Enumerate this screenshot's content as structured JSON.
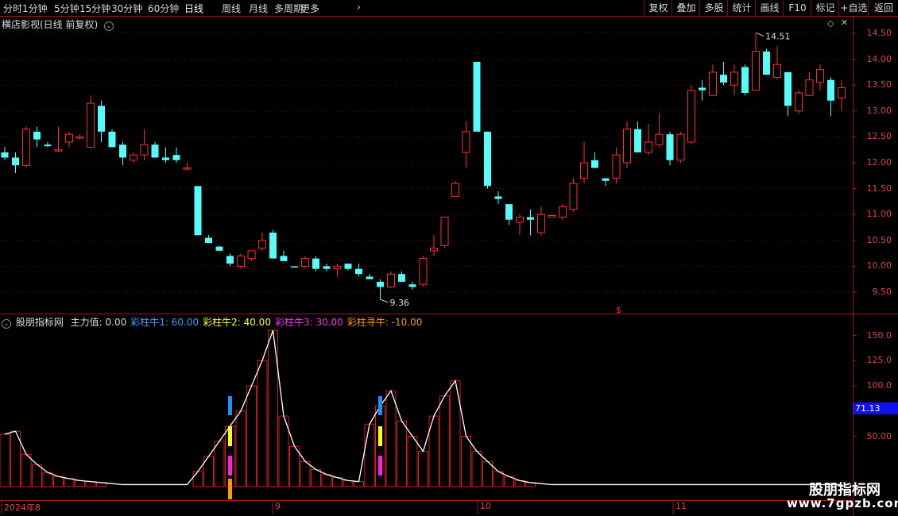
{
  "toolbar": {
    "periods": [
      "分时",
      "1分钟",
      "5分钟",
      "15分钟",
      "30分钟",
      "60分钟",
      "日线",
      "周线",
      "月线",
      "多周期",
      "更多"
    ],
    "active_period": "日线",
    "right_buttons": [
      "复权",
      "叠加",
      "多股",
      "统计",
      "画线",
      "F10",
      "标记",
      "+自选",
      "返回"
    ]
  },
  "main_chart": {
    "title": "横店影视(日线 前复权)",
    "y_ticks": [
      "14.50",
      "14.00",
      "13.50",
      "13.00",
      "12.50",
      "12.00",
      "11.50",
      "11.00",
      "10.50",
      "10.00",
      "9.50"
    ],
    "high_label": "14.51",
    "low_label": "9.36",
    "marker_label": "$"
  },
  "indicator": {
    "name": "股朋指标网",
    "legend": [
      {
        "text": "主力值: 0.00",
        "color": "#dddddd"
      },
      {
        "text": "彩柱牛1: 60.00",
        "color": "#3aa0ff"
      },
      {
        "text": "彩柱牛2: 40.00",
        "color": "#ffff00"
      },
      {
        "text": "彩柱牛3: 30.00",
        "color": "#ff30ff"
      },
      {
        "text": "彩柱寻牛: -10.00",
        "color": "#ff9900"
      }
    ],
    "y_ticks": [
      "150.0",
      "125.0",
      "100.0",
      "75.00",
      "50.00"
    ],
    "current_value": "71.13"
  },
  "x_axis": {
    "labels": [
      "2024年8",
      "9",
      "10",
      "11"
    ]
  },
  "watermark": {
    "line1": "股朋指标网",
    "line2": "www.7gpzb.com"
  },
  "chart_data": {
    "type": "candlestick",
    "ohlc": [
      [
        12.2,
        12.3,
        12.05,
        12.1
      ],
      [
        12.1,
        12.2,
        11.8,
        11.95
      ],
      [
        11.95,
        12.7,
        11.9,
        12.65
      ],
      [
        12.6,
        12.7,
        12.3,
        12.45
      ],
      [
        12.35,
        12.4,
        12.3,
        12.32
      ],
      [
        12.25,
        12.7,
        12.2,
        12.25
      ],
      [
        12.4,
        12.6,
        12.3,
        12.55
      ],
      [
        12.5,
        12.55,
        12.45,
        12.5
      ],
      [
        12.3,
        13.3,
        12.28,
        13.15
      ],
      [
        13.1,
        13.2,
        12.4,
        12.6
      ],
      [
        12.6,
        12.65,
        12.3,
        12.3
      ],
      [
        12.35,
        12.4,
        11.95,
        12.1
      ],
      [
        12.05,
        12.2,
        12.0,
        12.15
      ],
      [
        12.15,
        12.65,
        12.05,
        12.35
      ],
      [
        12.35,
        12.4,
        12.1,
        12.1
      ],
      [
        12.1,
        12.3,
        12.0,
        12.05
      ],
      [
        12.15,
        12.3,
        12.0,
        12.05
      ],
      [
        11.9,
        12.0,
        11.85,
        11.9
      ],
      [
        11.55,
        11.55,
        10.6,
        10.6
      ],
      [
        10.55,
        10.6,
        10.45,
        10.45
      ],
      [
        10.38,
        10.4,
        10.3,
        10.3
      ],
      [
        10.2,
        10.25,
        10.0,
        10.05
      ],
      [
        10.0,
        10.25,
        9.95,
        10.2
      ],
      [
        10.15,
        10.3,
        10.1,
        10.3
      ],
      [
        10.35,
        10.65,
        10.3,
        10.5
      ],
      [
        10.65,
        10.7,
        10.2,
        10.15
      ],
      [
        10.2,
        10.3,
        10.1,
        10.1
      ],
      [
        10.0,
        10.0,
        9.98,
        9.99
      ],
      [
        10.0,
        10.2,
        9.95,
        10.15
      ],
      [
        10.15,
        10.2,
        9.9,
        9.95
      ],
      [
        10.0,
        10.05,
        9.9,
        9.95
      ],
      [
        9.95,
        10.05,
        9.8,
        10.0
      ],
      [
        10.05,
        10.05,
        9.92,
        9.95
      ],
      [
        9.95,
        10.05,
        9.8,
        9.85
      ],
      [
        9.8,
        9.85,
        9.75,
        9.75
      ],
      [
        9.7,
        9.75,
        9.36,
        9.6
      ],
      [
        9.6,
        9.9,
        9.58,
        9.85
      ],
      [
        9.85,
        9.9,
        9.7,
        9.7
      ],
      [
        9.65,
        9.7,
        9.55,
        9.6
      ],
      [
        9.65,
        10.2,
        9.6,
        10.15
      ],
      [
        10.3,
        10.6,
        10.2,
        10.35
      ],
      [
        10.4,
        10.95,
        10.35,
        10.95
      ],
      [
        11.35,
        11.65,
        11.35,
        11.6
      ],
      [
        12.2,
        12.8,
        11.9,
        12.6
      ],
      [
        13.95,
        13.95,
        12.6,
        12.6
      ],
      [
        12.6,
        12.6,
        11.5,
        11.55
      ],
      [
        11.35,
        11.45,
        11.2,
        11.3
      ],
      [
        11.2,
        11.2,
        10.8,
        10.9
      ],
      [
        10.85,
        11.0,
        10.6,
        10.95
      ],
      [
        10.95,
        11.1,
        10.6,
        10.9
      ],
      [
        10.65,
        11.15,
        10.6,
        11.0
      ],
      [
        10.95,
        11.0,
        10.95,
        10.98
      ],
      [
        10.95,
        11.2,
        10.9,
        11.15
      ],
      [
        11.1,
        11.7,
        11.05,
        11.6
      ],
      [
        11.7,
        12.4,
        11.6,
        12.0
      ],
      [
        12.05,
        12.2,
        11.9,
        11.9
      ],
      [
        11.7,
        11.7,
        11.55,
        11.65
      ],
      [
        11.7,
        12.3,
        11.6,
        12.15
      ],
      [
        12.0,
        12.8,
        11.9,
        12.65
      ],
      [
        12.65,
        12.8,
        12.2,
        12.2
      ],
      [
        12.2,
        12.75,
        12.15,
        12.4
      ],
      [
        12.35,
        12.95,
        12.3,
        12.55
      ],
      [
        12.55,
        12.6,
        11.95,
        12.05
      ],
      [
        12.05,
        12.6,
        12.0,
        12.55
      ],
      [
        12.4,
        13.5,
        12.35,
        13.4
      ],
      [
        13.45,
        13.6,
        13.2,
        13.4
      ],
      [
        13.3,
        13.9,
        13.3,
        13.75
      ],
      [
        13.7,
        13.95,
        13.5,
        13.55
      ],
      [
        13.5,
        13.9,
        13.3,
        13.75
      ],
      [
        13.85,
        13.9,
        13.3,
        13.35
      ],
      [
        13.4,
        14.51,
        13.4,
        14.15
      ],
      [
        14.15,
        14.2,
        13.8,
        13.7
      ],
      [
        13.65,
        14.25,
        13.6,
        13.9
      ],
      [
        13.75,
        13.75,
        12.9,
        13.1
      ],
      [
        13.0,
        13.4,
        12.95,
        13.35
      ],
      [
        13.3,
        13.75,
        13.3,
        13.6
      ],
      [
        13.55,
        13.9,
        13.4,
        13.8
      ],
      [
        13.6,
        13.65,
        12.9,
        13.2
      ],
      [
        13.25,
        13.6,
        13.0,
        13.45
      ]
    ],
    "indicator_values": [
      52,
      55,
      32,
      22,
      14,
      10,
      8,
      6,
      5,
      4,
      3,
      2,
      2,
      2,
      2,
      2,
      2,
      2,
      15,
      30,
      45,
      60,
      75,
      100,
      125,
      155,
      70,
      40,
      25,
      17,
      12,
      9,
      6,
      5,
      62,
      80,
      95,
      65,
      50,
      35,
      70,
      90,
      105,
      50,
      35,
      25,
      15,
      10,
      6,
      4,
      3,
      2,
      2,
      2,
      2,
      2,
      2,
      2,
      2,
      2,
      2,
      2,
      2,
      2,
      2,
      2,
      2,
      2,
      2,
      2,
      2,
      2,
      2,
      2,
      2,
      2,
      2,
      2,
      2
    ]
  }
}
